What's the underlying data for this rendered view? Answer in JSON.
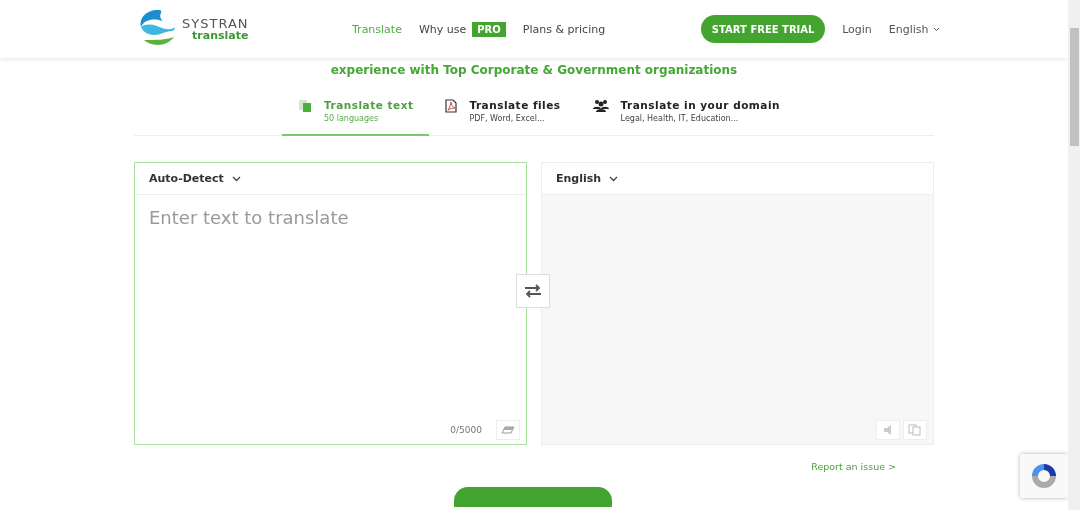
{
  "header": {
    "logo": {
      "brand": "SYSTRAN",
      "product": "translate"
    },
    "nav": [
      {
        "label": "Translate",
        "selected": true
      },
      {
        "label": "Why use",
        "selected": false,
        "badge": "PRO"
      },
      {
        "label": "Plans & pricing",
        "selected": false
      }
    ],
    "trial_button": "START FREE TRIAL",
    "login": "Login",
    "language": "English"
  },
  "tagline": "experience with Top Corporate & Government organizations",
  "tabs": [
    {
      "kind": "text",
      "title": "Translate text",
      "subtitle": "50 languages",
      "selected": true
    },
    {
      "kind": "files",
      "title": "Translate files",
      "subtitle": "PDF, Word, Excel...",
      "selected": false
    },
    {
      "kind": "domain",
      "title": "Translate in your domain",
      "subtitle": "Legal, Health, IT, Education...",
      "selected": false
    }
  ],
  "source": {
    "language": "Auto-Detect",
    "placeholder": "Enter text to translate",
    "counter": "0/5000"
  },
  "target": {
    "language": "English"
  },
  "report_link": "Report an issue >"
}
